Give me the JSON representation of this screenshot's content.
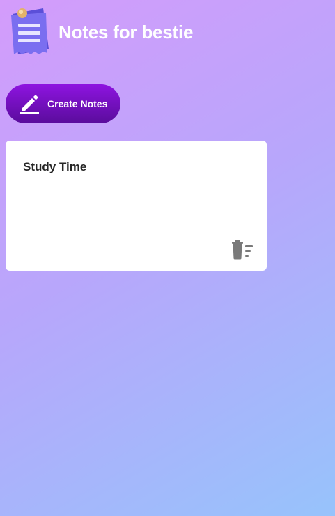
{
  "header": {
    "logo_icon": "notepad-icon",
    "title": "Notes for bestie"
  },
  "toolbar": {
    "create_label": "Create Notes",
    "create_icon": "pencil-icon"
  },
  "notes": [
    {
      "title": "Study Time",
      "delete_icon": "delete-note-icon"
    }
  ],
  "colors": {
    "background_start": "#d49cfb",
    "background_end": "#97c3fb",
    "button_top": "#8e14e0",
    "button_bottom": "#5a0c9c",
    "card": "#ffffff",
    "icon_gray": "#7a7a7a"
  }
}
